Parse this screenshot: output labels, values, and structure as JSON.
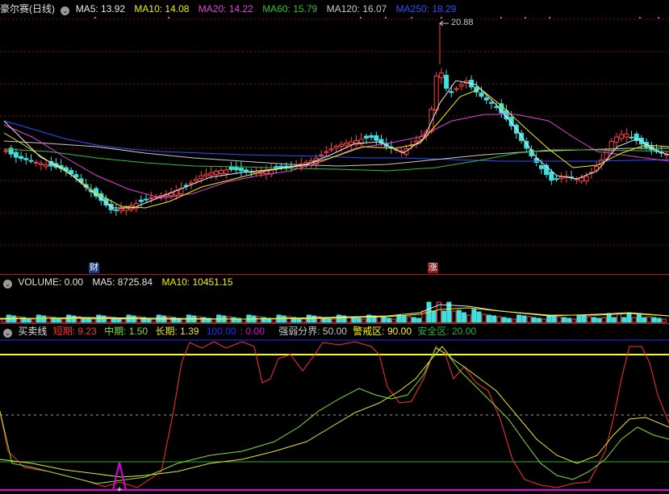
{
  "main_legend": {
    "title": "豪尔赛(日线)",
    "ma5": "MA5: 13.92",
    "ma10": "MA10: 14.08",
    "ma20": "MA20: 14.22",
    "ma60": "MA60: 15.79",
    "ma120": "MA120: 16.07",
    "ma250": "MA250: 18.29"
  },
  "price_high_label": "20.88",
  "markers": {
    "cai": "财",
    "zhang": "涨"
  },
  "volume_legend": {
    "title": "VOLUME: 0.00",
    "ma5": "MA5: 8725.84",
    "ma10": "MA10: 10451.15"
  },
  "indicator_legend": {
    "title": "买卖线",
    "short": "短期: 9.23",
    "mid": "中期: 1.50",
    "long": "长期: 1.39",
    "l100": "100.00",
    "l0": ": 0.00",
    "strength": "强弱分界: 50.00",
    "alert": "警戒区: 90.00",
    "safe": "安全区: 20.00"
  },
  "colors": {
    "ma5": "#e8e8e8",
    "ma10": "#f0f000",
    "ma20": "#e040e0",
    "ma60": "#30c030",
    "ma120": "#c8c8c8",
    "ma250": "#3050ff",
    "up": "#ff4040",
    "down": "#40e0e0",
    "short": "#ff3030",
    "mid": "#80e030",
    "long": "#e8e820",
    "alert": "#ffff00",
    "safe": "#30b030"
  }
}
